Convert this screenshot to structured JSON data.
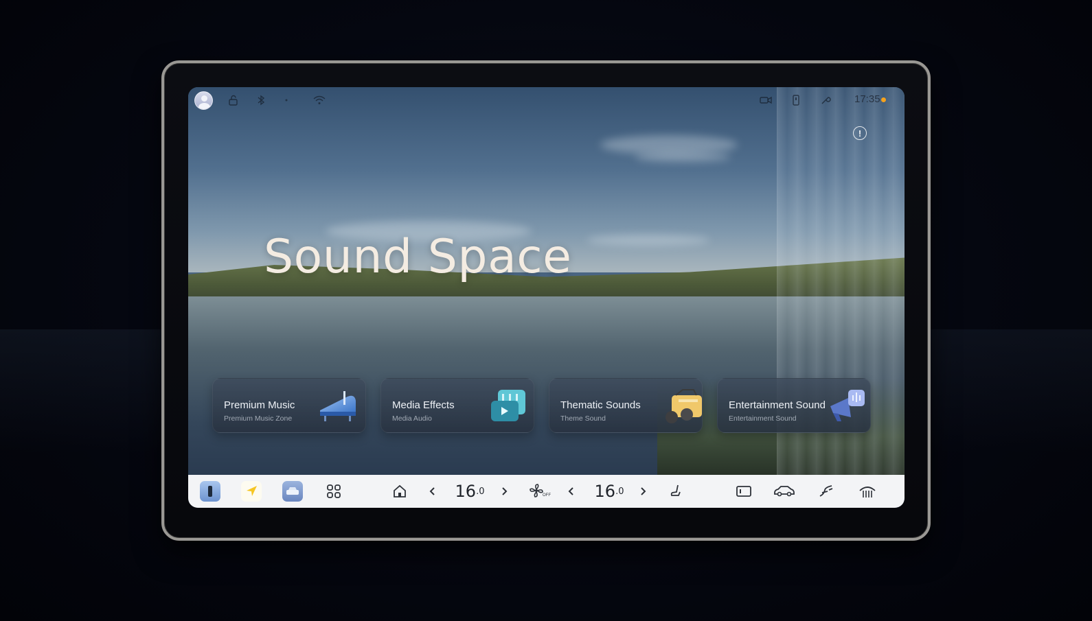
{
  "status_bar": {
    "time": "17:35",
    "icons": [
      "user-avatar",
      "unlock-icon",
      "bluetooth-icon",
      "dot-icon",
      "wifi-icon",
      "camera-icon",
      "phone-key-icon",
      "wrench-icon",
      "notification-dot"
    ]
  },
  "hero": {
    "title": "Sound Space"
  },
  "alert": {
    "symbol": "!"
  },
  "cards": [
    {
      "title": "Premium Music",
      "subtitle": "Premium Music Zone",
      "icon": "piano-icon"
    },
    {
      "title": "Media Effects",
      "subtitle": "Media Audio",
      "icon": "media-player-icon"
    },
    {
      "title": "Thematic Sounds",
      "subtitle": "Theme Sound",
      "icon": "radio-icon"
    },
    {
      "title": "Entertainment Sound",
      "subtitle": "Entertainment Sound",
      "icon": "megaphone-icon"
    }
  ],
  "dock": {
    "left_temp": {
      "value": "16",
      "decimal": ".0"
    },
    "right_temp": {
      "value": "16",
      "decimal": ".0"
    },
    "fan_status": "OFF",
    "colors": {
      "app_blue": "#7fa8dc",
      "nav_yellow": "#f6d23a",
      "car_blue": "#6d8fc6",
      "orange_dot": "#f5a21d"
    }
  }
}
